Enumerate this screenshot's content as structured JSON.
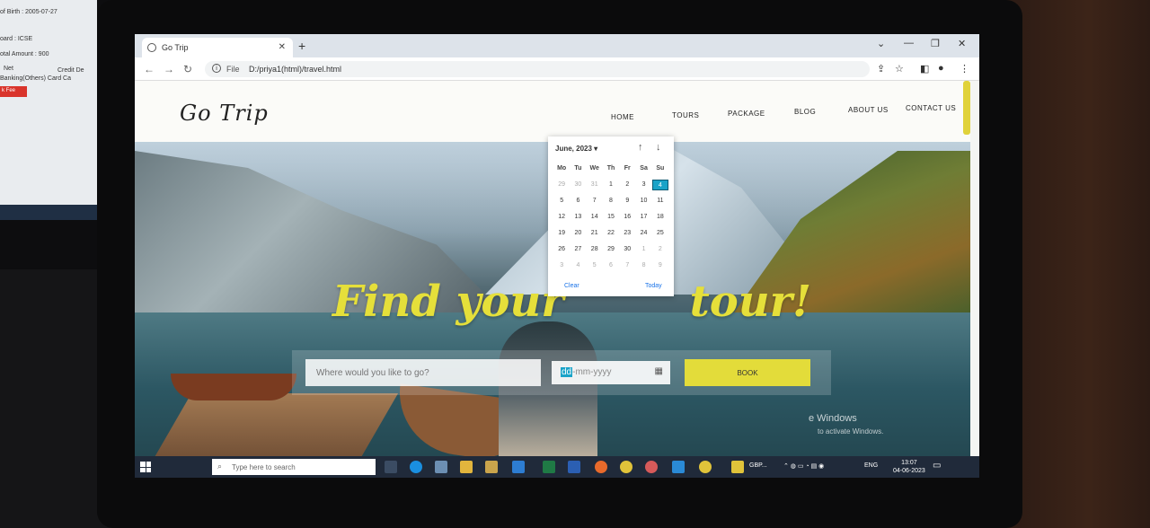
{
  "left_monitor": {
    "dob": "of Birth : 2005-07-27",
    "board": "oard : ICSE",
    "total": "otal Amount : 900",
    "net": "Net",
    "credit": "Credit  De",
    "banking": "Banking(Others)  Card    Ca",
    "button": "k Fee"
  },
  "browser": {
    "tab_title": "Go Trip",
    "new_tab": "+",
    "address_prefix": "File",
    "address": "D:/priya1(html)/travel.html"
  },
  "site": {
    "logo": "Go Trip",
    "nav": [
      "HOME",
      "TOURS",
      "PACKAGE",
      "BLOG",
      "ABOUT US",
      "CONTACT US"
    ],
    "headline_left": "Find your",
    "headline_right": "tour!",
    "destination_placeholder": "Where would you like to go?",
    "date_dd": "dd",
    "date_rest": "-mm-yyyy",
    "book_label": "BOOK"
  },
  "datepicker": {
    "month_label": "June, 2023 ▾",
    "weekdays": [
      "Mo",
      "Tu",
      "We",
      "Th",
      "Fr",
      "Sa",
      "Su"
    ],
    "rows": [
      [
        "29",
        "30",
        "31",
        "1",
        "2",
        "3",
        "4"
      ],
      [
        "5",
        "6",
        "7",
        "8",
        "9",
        "10",
        "11"
      ],
      [
        "12",
        "13",
        "14",
        "15",
        "16",
        "17",
        "18"
      ],
      [
        "19",
        "20",
        "21",
        "22",
        "23",
        "24",
        "25"
      ],
      [
        "26",
        "27",
        "28",
        "29",
        "30",
        "1",
        "2"
      ],
      [
        "3",
        "4",
        "5",
        "6",
        "7",
        "8",
        "9"
      ]
    ],
    "selected": "4",
    "clear_label": "Clear",
    "today_label": "Today"
  },
  "watermark": {
    "line1": "e Windows",
    "line2": "to activate Windows."
  },
  "taskbar": {
    "search_placeholder": "Type here to search",
    "weather_app": "GBP...",
    "language": "ENG",
    "time": "13:07",
    "date": "04-06-2023"
  },
  "colors": {
    "accent_yellow": "#e3dc3a",
    "picker_today": "#1aa3c8",
    "taskbar": "#202a3a"
  }
}
